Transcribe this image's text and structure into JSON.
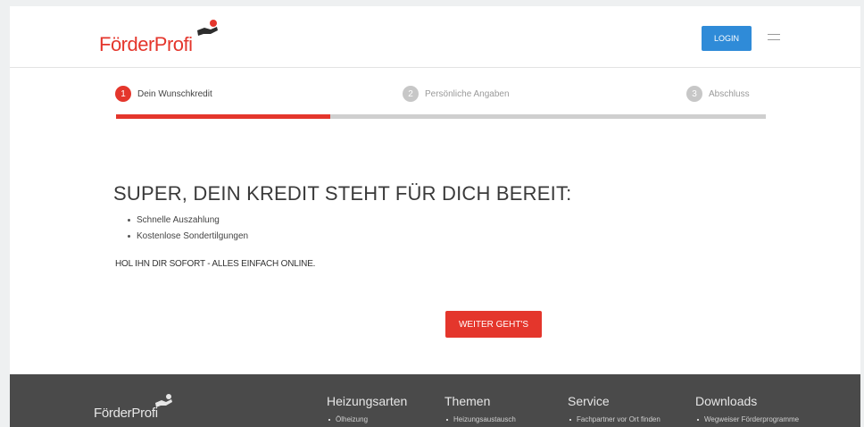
{
  "header": {
    "logo_text": "FörderProfi",
    "login_label": "LOGIN"
  },
  "steps": [
    {
      "number": "1",
      "label": "Dein Wunschkredit",
      "active": true
    },
    {
      "number": "2",
      "label": "Persönliche Angaben",
      "active": false
    },
    {
      "number": "3",
      "label": "Abschluss",
      "active": false
    }
  ],
  "progress": {
    "fraction": 0.33
  },
  "main": {
    "headline": "SUPER, DEIN KREDIT STEHT FÜR DICH BEREIT:",
    "bullets": [
      "Schnelle Auszahlung",
      "Kostenlose Sondertilgungen"
    ],
    "tagline": "HOL IHN DIR SOFORT - ALLES EINFACH ONLINE.",
    "cta_label": "WEITER GEHT'S"
  },
  "footer": {
    "logo_text": "FörderProfi",
    "columns": [
      {
        "title": "Heizungsarten",
        "link": "Ölheizung"
      },
      {
        "title": "Themen",
        "link": "Heizungsaustausch"
      },
      {
        "title": "Service",
        "link": "Fachpartner vor Ort finden"
      },
      {
        "title": "Downloads",
        "link": "Wegweiser Förderprogramme"
      }
    ]
  },
  "colors": {
    "accent": "#e4362c",
    "login_blue": "#2f8bd8",
    "footer_bg": "#4a4a4a"
  }
}
